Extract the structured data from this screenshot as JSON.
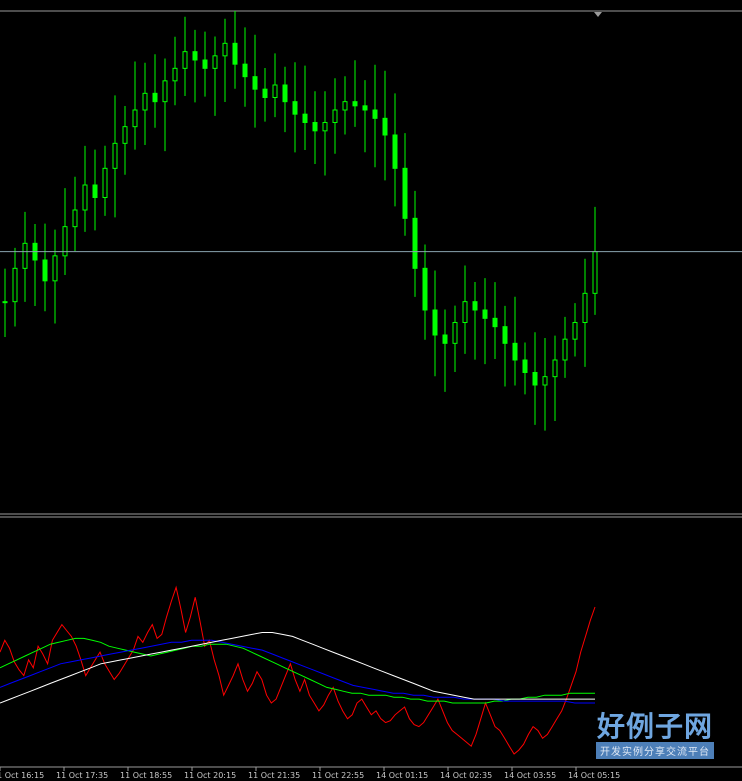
{
  "chart_data": [
    {
      "type": "candlestick",
      "title": "",
      "colors": {
        "background": "#000000",
        "candle": "#00ff00",
        "price_line": "#8aa4b0",
        "separator": "#9a9a9a"
      },
      "grid": false,
      "current_price_line": true,
      "close_series": [
        1.235,
        1.2358,
        1.2364,
        1.236,
        1.2355,
        1.2361,
        1.2368,
        1.2372,
        1.2378,
        1.2375,
        1.2382,
        1.2388,
        1.2392,
        1.2396,
        1.24,
        1.2398,
        1.2403,
        1.2406,
        1.241,
        1.2408,
        1.2406,
        1.2409,
        1.2412,
        1.2407,
        1.2404,
        1.2401,
        1.2399,
        1.2402,
        1.2398,
        1.2395,
        1.2393,
        1.2391,
        1.2393,
        1.2396,
        1.2398,
        1.2397,
        1.2396,
        1.2394,
        1.239,
        1.2382,
        1.237,
        1.2358,
        1.2348,
        1.2342,
        1.234,
        1.2345,
        1.235,
        1.2348,
        1.2346,
        1.2344,
        1.234,
        1.2336,
        1.2333,
        1.233,
        1.2332,
        1.2336,
        1.2341,
        1.2345,
        1.2352,
        1.2362
      ],
      "ylim": [
        1.23,
        1.242
      ]
    },
    {
      "type": "line",
      "title": "",
      "series": [
        {
          "color": "#ff0000",
          "values": [
            52,
            58,
            54,
            47,
            43,
            40,
            48,
            44,
            55,
            51,
            46,
            58,
            62,
            66,
            63,
            60,
            55,
            48,
            40,
            44,
            48,
            52,
            46,
            42,
            38,
            41,
            45,
            49,
            53,
            60,
            57,
            62,
            66,
            59,
            61,
            70,
            78,
            85,
            74,
            62,
            70,
            80,
            68,
            55,
            58,
            48,
            40,
            30,
            35,
            40,
            46,
            38,
            32,
            36,
            42,
            38,
            30,
            26,
            28,
            34,
            40,
            46,
            38,
            32,
            38,
            30,
            26,
            22,
            25,
            30,
            34,
            27,
            22,
            18,
            20,
            26,
            28,
            24,
            20,
            22,
            18,
            16,
            17,
            20,
            22,
            24,
            18,
            15,
            14,
            16,
            20,
            24,
            28,
            22,
            16,
            12,
            10,
            8,
            6,
            4,
            10,
            18,
            26,
            20,
            14,
            12,
            8,
            4,
            0,
            2,
            5,
            10,
            14,
            12,
            8,
            10,
            14,
            18,
            22,
            28,
            35,
            42,
            52,
            60,
            68,
            75
          ]
        },
        {
          "color": "#00ff00",
          "values": [
            44,
            46,
            48,
            50,
            52,
            54,
            56,
            57,
            58,
            59,
            59,
            58,
            57,
            55,
            54,
            53,
            52,
            51,
            50,
            51,
            52,
            53,
            54,
            55,
            55,
            56,
            56,
            56,
            55,
            54,
            52,
            50,
            48,
            46,
            44,
            42,
            40,
            38,
            36,
            34,
            33,
            32,
            31,
            31,
            30,
            30,
            30,
            29,
            29,
            28,
            28,
            27,
            27,
            27,
            26,
            26,
            26,
            26,
            26,
            27,
            27,
            28,
            28,
            29,
            29,
            30,
            30,
            30,
            31,
            31,
            31,
            31
          ]
        },
        {
          "color": "#0000ff",
          "values": [
            34,
            36,
            38,
            40,
            42,
            44,
            46,
            47,
            48,
            49,
            50,
            51,
            52,
            53,
            54,
            55,
            56,
            57,
            57,
            58,
            58,
            58,
            57,
            56,
            55,
            54,
            53,
            51,
            49,
            47,
            45,
            43,
            41,
            39,
            37,
            35,
            34,
            33,
            32,
            31,
            31,
            30,
            30,
            29,
            29,
            29,
            28,
            28,
            28,
            28,
            27,
            27,
            27,
            27,
            27,
            27,
            27,
            26,
            26,
            26
          ]
        },
        {
          "color": "#ffffff",
          "values": [
            26,
            28,
            30,
            32,
            34,
            36,
            38,
            40,
            42,
            44,
            46,
            47,
            48,
            49,
            50,
            51,
            52,
            53,
            54,
            55,
            56,
            57,
            58,
            59,
            60,
            61,
            62,
            62,
            61,
            60,
            58,
            56,
            54,
            52,
            50,
            48,
            46,
            44,
            42,
            40,
            38,
            36,
            34,
            32,
            31,
            30,
            29,
            28,
            28,
            28,
            28,
            28,
            28,
            28,
            28,
            28,
            28,
            28,
            28,
            28
          ]
        }
      ],
      "ylim": [
        0,
        100
      ],
      "x_tick_labels": [
        "11 Oct 16:15",
        "11 Oct 17:35",
        "11 Oct 18:55",
        "11 Oct 20:15",
        "11 Oct 21:35",
        "11 Oct 22:55",
        "14 Oct 01:15",
        "14 Oct 02:35",
        "14 Oct 03:55",
        "14 Oct 05:15"
      ]
    }
  ],
  "watermark": {
    "main": "好例子网",
    "sub": "开发实例分享交流平台"
  }
}
